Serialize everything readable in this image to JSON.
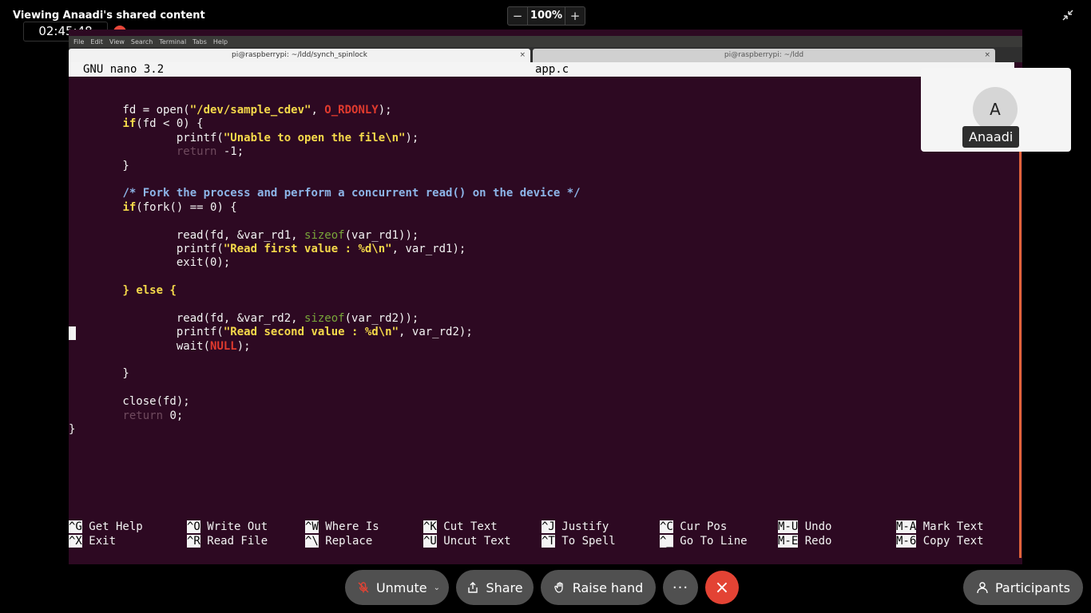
{
  "meeting": {
    "viewing_title": "Viewing Anaadi's shared content",
    "timer": "02:45:48",
    "zoom_value": "100%",
    "zoom_minus": "−",
    "zoom_plus": "+"
  },
  "terminal": {
    "menu": [
      "File",
      "Edit",
      "View",
      "Search",
      "Terminal",
      "Tabs",
      "Help"
    ],
    "tabs": [
      {
        "label": "pi@raspberrypi: ~/ldd/synch_spinlock",
        "active": true
      },
      {
        "label": "pi@raspberrypi: ~/ldd",
        "active": false
      }
    ],
    "tab_close": "×",
    "nano_version": "GNU nano 3.2",
    "file_name": "app.c"
  },
  "code_lines": [
    "        fd = open(\"/dev/sample_cdev\", O_RDONLY);",
    "        if(fd < 0) {",
    "                printf(\"Unable to open the file\\n\");",
    "                return -1;",
    "        }",
    "",
    "        /* Fork the process and perform a concurrent read() on the device */",
    "        if(fork() == 0) {",
    "",
    "                read(fd, &var_rd1, sizeof(var_rd1));",
    "                printf(\"Read first value : %d\\n\", var_rd1);",
    "                exit(0);",
    "",
    "        } else {",
    "",
    "                read(fd, &var_rd2, sizeof(var_rd2));",
    "                printf(\"Read second value : %d\\n\", var_rd2);",
    "                wait(NULL);",
    "",
    "        }",
    "",
    "        close(fd);",
    "        return 0;",
    "}"
  ],
  "shortcuts": [
    {
      "key": "^G",
      "label": "Get Help"
    },
    {
      "key": "^X",
      "label": "Exit"
    },
    {
      "key": "^O",
      "label": "Write Out"
    },
    {
      "key": "^R",
      "label": "Read File"
    },
    {
      "key": "^W",
      "label": "Where Is"
    },
    {
      "key": "^\\",
      "label": "Replace"
    },
    {
      "key": "^K",
      "label": "Cut Text"
    },
    {
      "key": "^U",
      "label": "Uncut Text"
    },
    {
      "key": "^J",
      "label": "Justify"
    },
    {
      "key": "^T",
      "label": "To Spell"
    },
    {
      "key": "^C",
      "label": "Cur Pos"
    },
    {
      "key": "^_",
      "label": "Go To Line"
    },
    {
      "key": "M-U",
      "label": "Undo"
    },
    {
      "key": "M-E",
      "label": "Redo"
    },
    {
      "key": "M-A",
      "label": "Mark Text"
    },
    {
      "key": "M-6",
      "label": "Copy Text"
    }
  ],
  "participant": {
    "initial": "A",
    "name": "Anaadi"
  },
  "controls": {
    "unmute": "Unmute",
    "share": "Share",
    "raise_hand": "Raise hand",
    "more": "···",
    "leave": "×",
    "participants": "Participants"
  },
  "colors": {
    "terminal_bg": "#2d0922",
    "leave_red": "#e34334",
    "keyword_yellow": "#f5d94a",
    "macro_red": "#e03a2e",
    "builtin_green": "#79a63a",
    "comment_blue": "#8db5e8"
  }
}
